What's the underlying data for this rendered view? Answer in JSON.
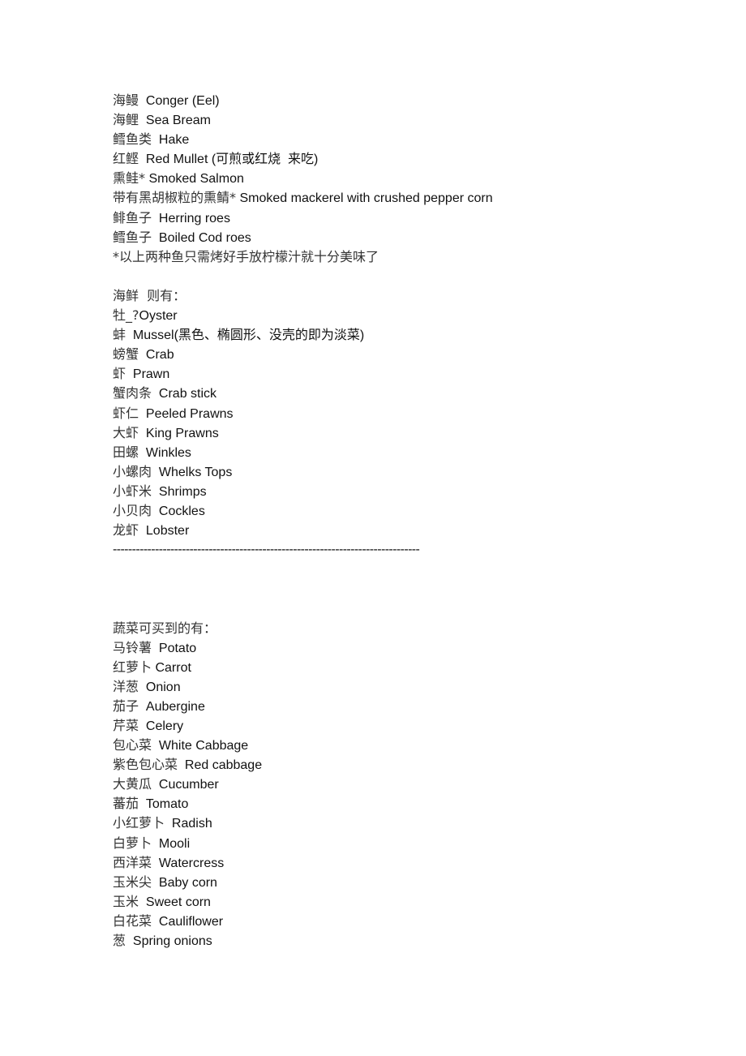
{
  "fish": {
    "items": [
      {
        "zh": "海鳗",
        "en": "Conger (Eel)"
      },
      {
        "zh": "海鲤",
        "en": "Sea Bream"
      },
      {
        "zh": "鳕鱼类",
        "en": "Hake"
      },
      {
        "zh": "红鲣",
        "en": "Red Mullet (可煎或红烧  来吃)"
      },
      {
        "zh": "熏鲑*",
        "en": "Smoked Salmon"
      },
      {
        "zh": "带有黑胡椒粒的熏鲭*",
        "en": "Smoked mackerel with crushed pepper corn"
      },
      {
        "zh": "鲱鱼子",
        "en": "Herring roes"
      },
      {
        "zh": "鳕鱼子",
        "en": "Boiled Cod roes"
      }
    ],
    "note": "*以上两种鱼只需烤好手放柠檬汁就十分美味了"
  },
  "seafood": {
    "heading": "海鲜  则有：",
    "items": [
      {
        "zh": "牡_?",
        "en": "Oyster"
      },
      {
        "zh": "蚌",
        "en": "Mussel(黑色、椭圆形、没壳的即为淡菜)"
      },
      {
        "zh": "螃蟹",
        "en": "Crab"
      },
      {
        "zh": "虾",
        "en": "Prawn"
      },
      {
        "zh": "蟹肉条",
        "en": "Crab stick"
      },
      {
        "zh": "虾仁",
        "en": "Peeled Prawns"
      },
      {
        "zh": "大虾",
        "en": "King Prawns"
      },
      {
        "zh": "田螺",
        "en": "Winkles"
      },
      {
        "zh": "小螺肉",
        "en": "Whelks Tops"
      },
      {
        "zh": "小虾米",
        "en": "Shrimps"
      },
      {
        "zh": "小贝肉",
        "en": "Cockles"
      },
      {
        "zh": "龙虾",
        "en": "Lobster"
      }
    ]
  },
  "divider": "--------------------------------------------------------------------------------",
  "vegetables": {
    "heading": "蔬菜可买到的有：",
    "items": [
      {
        "zh": "马铃薯",
        "en": "Potato"
      },
      {
        "zh": "红萝卜",
        "en": "Carrot"
      },
      {
        "zh": "洋葱",
        "en": "Onion"
      },
      {
        "zh": "茄子",
        "en": "Aubergine"
      },
      {
        "zh": "芹菜",
        "en": "Celery"
      },
      {
        "zh": "包心菜",
        "en": "White Cabbage"
      },
      {
        "zh": "紫色包心菜",
        "en": "Red cabbage"
      },
      {
        "zh": "大黄瓜",
        "en": "Cucumber"
      },
      {
        "zh": "蕃茄",
        "en": "Tomato"
      },
      {
        "zh": "小红萝卜",
        "en": "Radish"
      },
      {
        "zh": "白萝卜",
        "en": "Mooli"
      },
      {
        "zh": "西洋菜",
        "en": "Watercress"
      },
      {
        "zh": "玉米尖",
        "en": "Baby corn"
      },
      {
        "zh": "玉米",
        "en": "Sweet corn"
      },
      {
        "zh": "白花菜",
        "en": "Cauliflower"
      },
      {
        "zh": "葱",
        "en": "Spring onions"
      }
    ]
  }
}
